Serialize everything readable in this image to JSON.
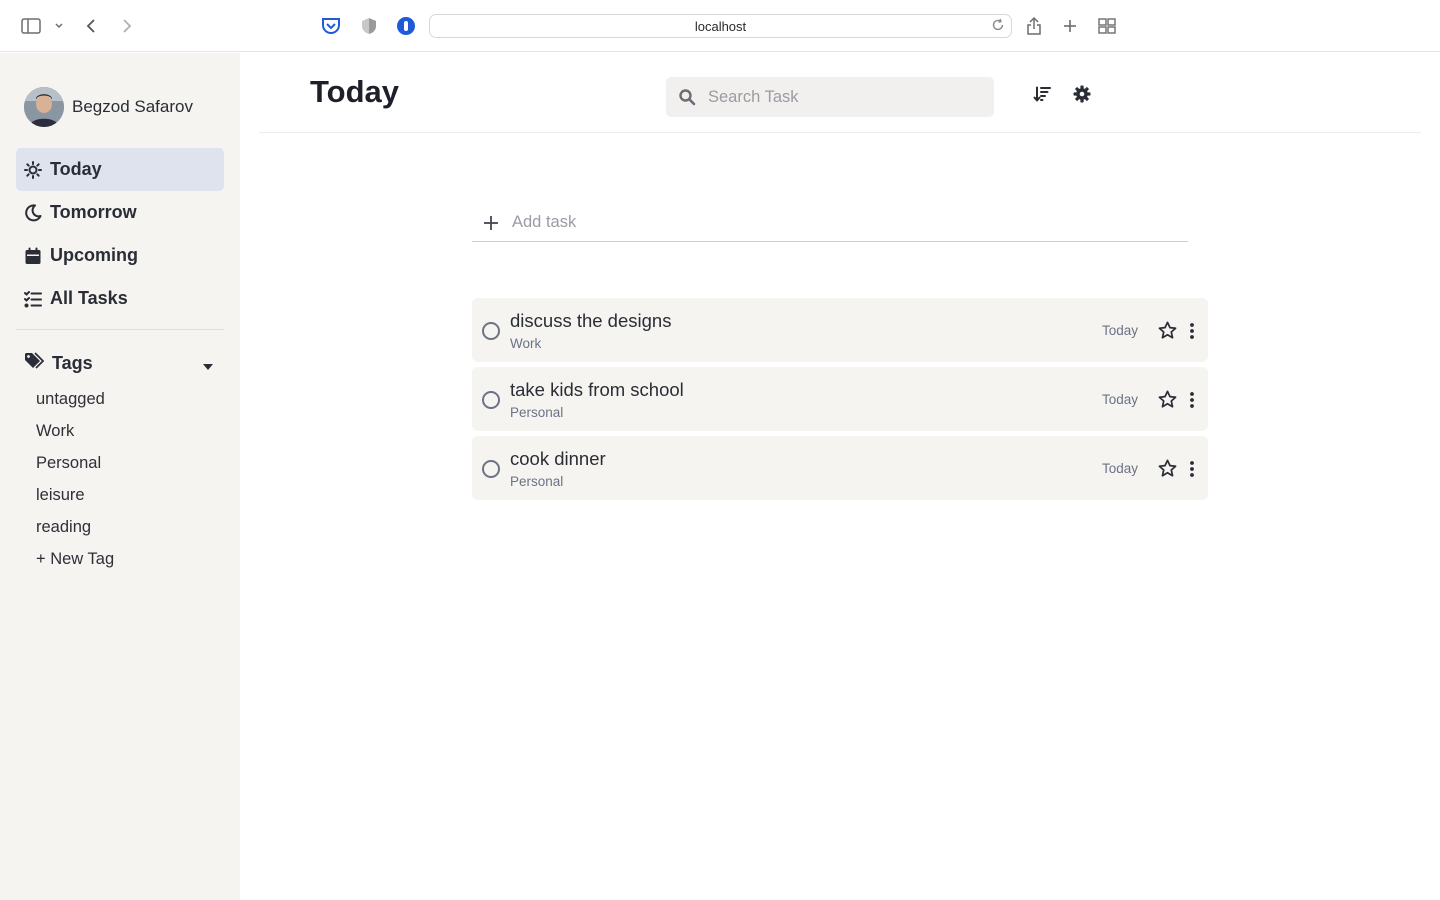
{
  "browser": {
    "url": "localhost"
  },
  "user": {
    "name": "Begzod Safarov"
  },
  "nav": {
    "items": [
      {
        "label": "Today",
        "icon": "sun-icon",
        "active": true
      },
      {
        "label": "Tomorrow",
        "icon": "moon-icon",
        "active": false
      },
      {
        "label": "Upcoming",
        "icon": "calendar-icon",
        "active": false
      },
      {
        "label": "All Tasks",
        "icon": "list-icon",
        "active": false
      }
    ]
  },
  "tags": {
    "heading": "Tags",
    "items": [
      "untagged",
      "Work",
      "Personal",
      "leisure",
      "reading"
    ],
    "new_tag_label": "+ New Tag"
  },
  "header": {
    "title": "Today",
    "search_placeholder": "Search Task"
  },
  "add_task": {
    "label": "Add task"
  },
  "tasks": [
    {
      "title": "discuss the designs",
      "tag": "Work",
      "due": "Today"
    },
    {
      "title": "take kids from school",
      "tag": "Personal",
      "due": "Today"
    },
    {
      "title": "cook dinner",
      "tag": "Personal",
      "due": "Today"
    }
  ],
  "colors": {
    "sidebar_bg": "#f5f4f1",
    "active_nav_bg": "#dfe3ee",
    "task_bg": "#f5f4f1",
    "muted_text": "#6c7286",
    "accent_blue": "#1f5bd8"
  }
}
